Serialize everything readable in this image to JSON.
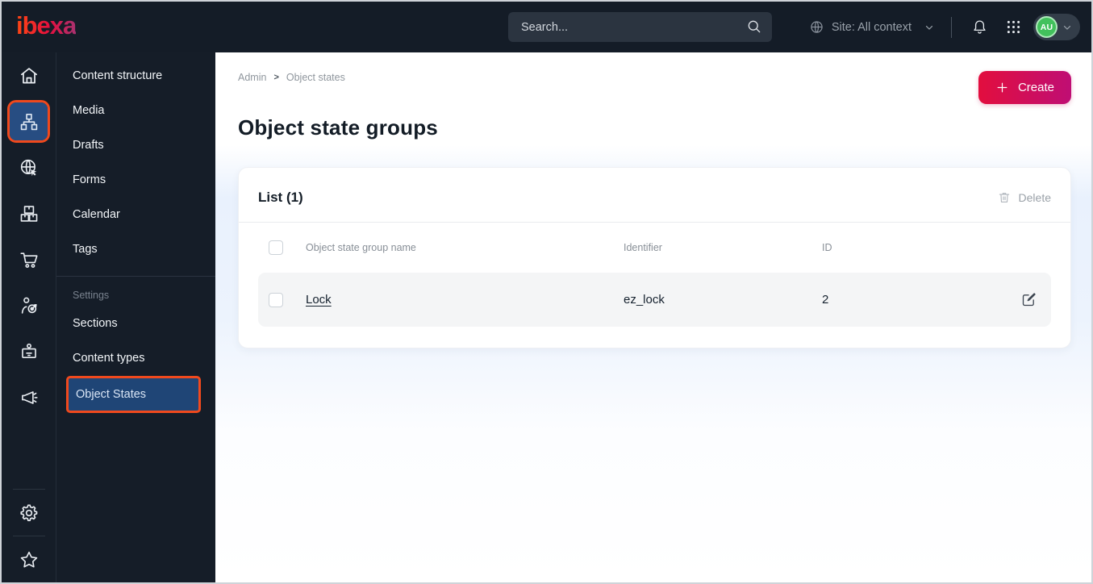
{
  "topbar": {
    "logo_text": "ibexa",
    "search_placeholder": "Search...",
    "site_label": "Site: All context",
    "avatar_initials": "AU"
  },
  "sidebar": {
    "items": [
      {
        "label": "Content structure"
      },
      {
        "label": "Media"
      },
      {
        "label": "Drafts"
      },
      {
        "label": "Forms"
      },
      {
        "label": "Calendar"
      },
      {
        "label": "Tags"
      }
    ],
    "section_label": "Settings",
    "settings_items": [
      {
        "label": "Sections"
      },
      {
        "label": "Content types"
      },
      {
        "label": "Object States"
      }
    ]
  },
  "main": {
    "breadcrumb": {
      "root": "Admin",
      "current": "Object states"
    },
    "page_title": "Object state groups",
    "create_button": "Create",
    "list_card": {
      "title": "List (1)",
      "delete_button": "Delete",
      "columns": {
        "name": "Object state group name",
        "identifier": "Identifier",
        "id": "ID"
      },
      "rows": [
        {
          "name": "Lock",
          "identifier": "ez_lock",
          "id": "2"
        }
      ]
    }
  },
  "colors": {
    "topbar_bg": "#141c27",
    "highlight_orange": "#f0491d",
    "active_blue": "#274d82",
    "button_gradient_start": "#e20e3e",
    "button_gradient_end": "#bf0e74",
    "avatar_green": "#42c15c",
    "content_band_blue": "#e9f1fd"
  }
}
